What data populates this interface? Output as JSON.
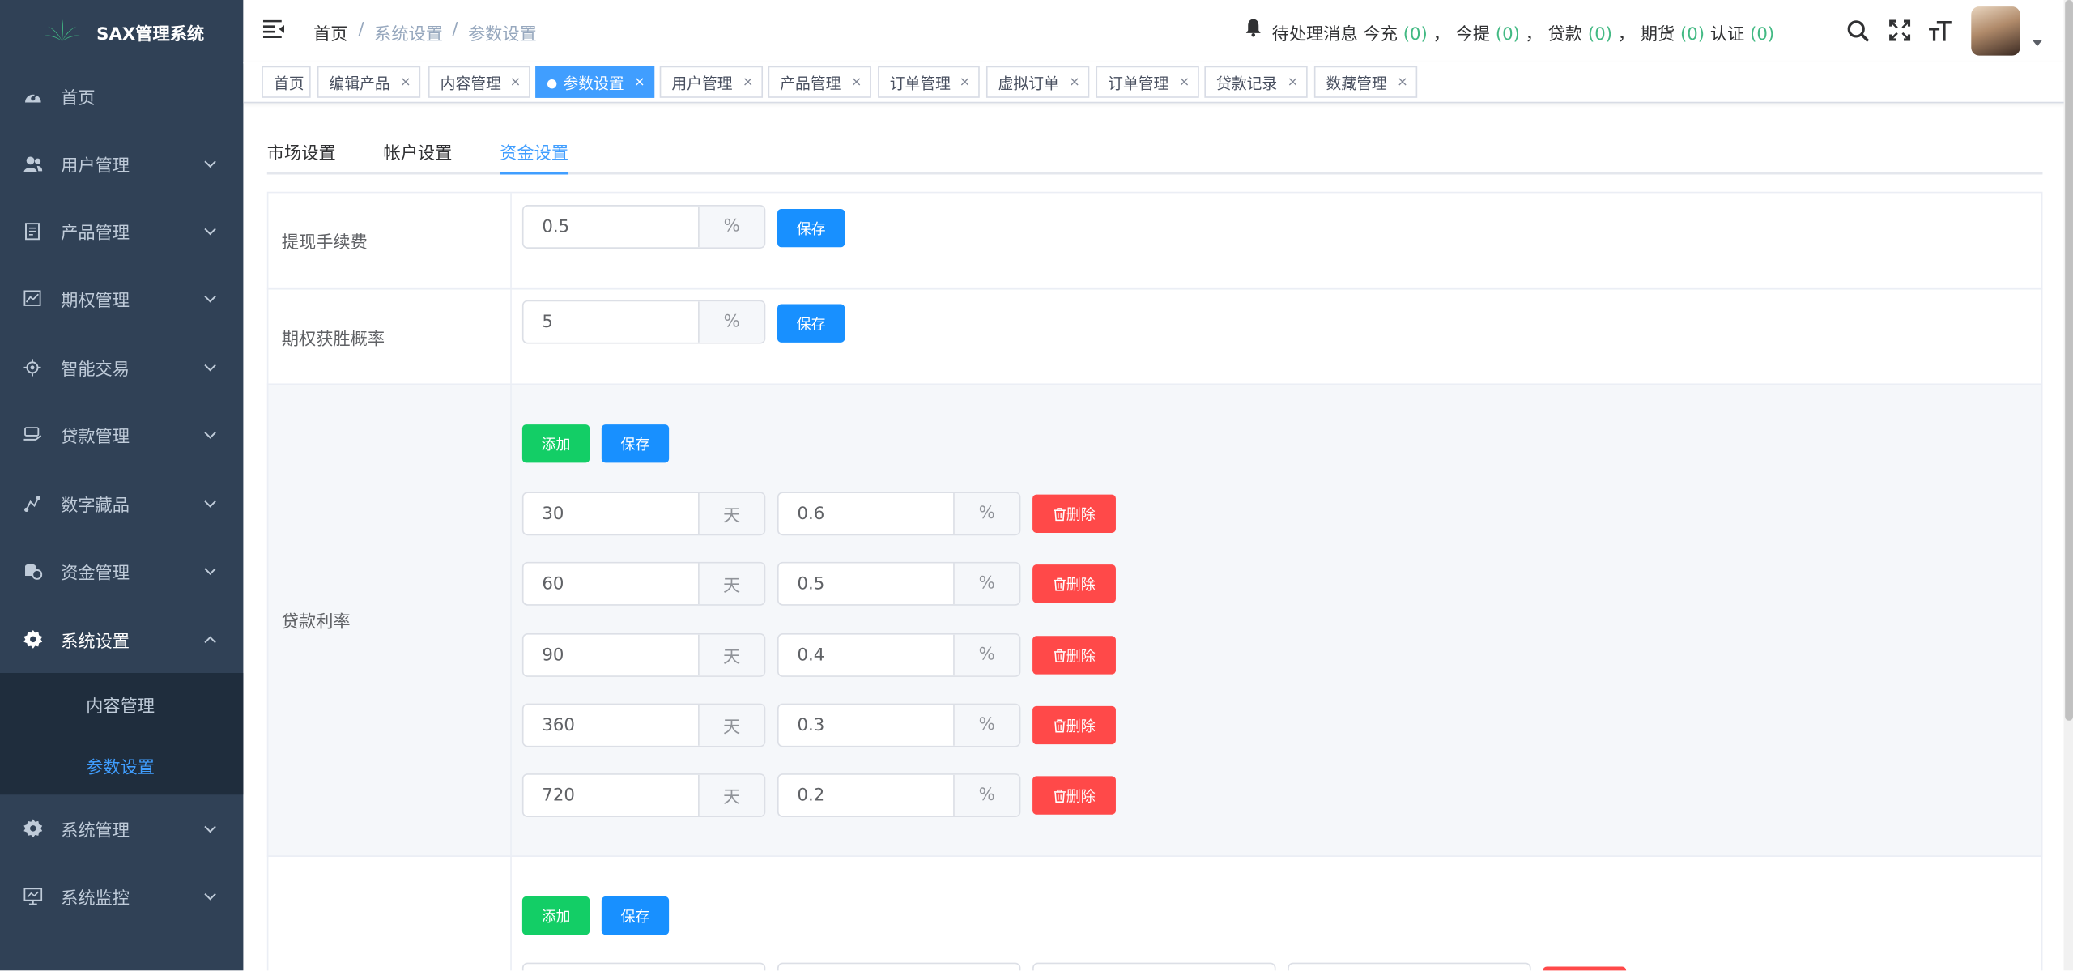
{
  "app": {
    "title": "SAX管理系统"
  },
  "sidebar": {
    "items": [
      {
        "label": "首页",
        "icon": "dashboard-icon"
      },
      {
        "label": "用户管理",
        "icon": "users-icon"
      },
      {
        "label": "产品管理",
        "icon": "document-icon"
      },
      {
        "label": "期权管理",
        "icon": "chart-icon"
      },
      {
        "label": "智能交易",
        "icon": "gear-icon"
      },
      {
        "label": "贷款管理",
        "icon": "loan-icon"
      },
      {
        "label": "数字藏品",
        "icon": "route-icon"
      },
      {
        "label": "资金管理",
        "icon": "money-icon"
      },
      {
        "label": "系统设置",
        "icon": "settings-icon"
      },
      {
        "label": "系统管理",
        "icon": "settings-icon"
      },
      {
        "label": "系统监控",
        "icon": "monitor-icon"
      }
    ],
    "submenu": [
      {
        "label": "内容管理",
        "active": false
      },
      {
        "label": "参数设置",
        "active": true
      }
    ]
  },
  "header": {
    "breadcrumb": [
      "首页",
      "系统设置",
      "参数设置"
    ],
    "breadcrumb_sep": "/",
    "notice": {
      "label": "待处理消息",
      "items": [
        {
          "label": "今充",
          "count": "(0)"
        },
        {
          "label": "今提",
          "count": "(0)"
        },
        {
          "label": "贷款",
          "count": "(0)"
        },
        {
          "label": "期货",
          "count": "(0)"
        },
        {
          "label": "认证",
          "count": "(0)"
        }
      ],
      "sep": "，"
    }
  },
  "tags": [
    {
      "label": "首页",
      "closable": false,
      "active": false
    },
    {
      "label": "编辑产品",
      "closable": true,
      "active": false
    },
    {
      "label": "内容管理",
      "closable": true,
      "active": false
    },
    {
      "label": "参数设置",
      "closable": true,
      "active": true
    },
    {
      "label": "用户管理",
      "closable": true,
      "active": false
    },
    {
      "label": "产品管理",
      "closable": true,
      "active": false
    },
    {
      "label": "订单管理",
      "closable": true,
      "active": false
    },
    {
      "label": "虚拟订单",
      "closable": true,
      "active": false
    },
    {
      "label": "订单管理",
      "closable": true,
      "active": false
    },
    {
      "label": "贷款记录",
      "closable": true,
      "active": false
    },
    {
      "label": "数藏管理",
      "closable": true,
      "active": false
    }
  ],
  "tag_close": "×",
  "tabs": [
    {
      "label": "市场设置",
      "active": false
    },
    {
      "label": "帐户设置",
      "active": false
    },
    {
      "label": "资金设置",
      "active": true
    }
  ],
  "settings": {
    "withdraw_fee": {
      "label": "提现手续费",
      "value": "0.5",
      "unit": "%",
      "save": "保存"
    },
    "option_win_rate": {
      "label": "期权获胜概率",
      "value": "5",
      "unit": "%",
      "save": "保存"
    },
    "loan_rate": {
      "label": "贷款利率",
      "add": "添加",
      "save": "保存",
      "delete": "删除",
      "day_unit": "天",
      "pct_unit": "%",
      "rows": [
        {
          "days": "30",
          "rate": "0.6"
        },
        {
          "days": "60",
          "rate": "0.5"
        },
        {
          "days": "90",
          "rate": "0.4"
        },
        {
          "days": "360",
          "rate": "0.3"
        },
        {
          "days": "720",
          "rate": "0.2"
        }
      ]
    },
    "next_section": {
      "add": "添加",
      "save": "保存"
    }
  }
}
